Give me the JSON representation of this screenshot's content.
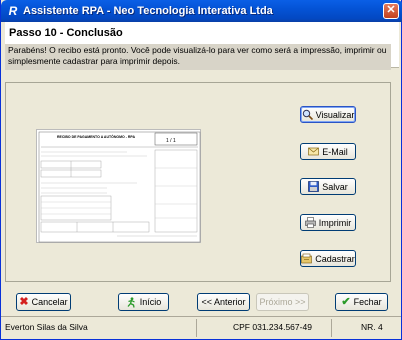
{
  "window": {
    "title": "Assistente RPA - Neo Tecnologia Interativa Ltda",
    "title_icon": "R",
    "close_label": "✕"
  },
  "step": {
    "title": "Passo 10 -  Conclusão",
    "info": "Parabéns! O recibo está pronto. Você pode visualizá-lo para ver como será a impressão, imprimir ou simplesmente cadastrar para imprimir depois."
  },
  "actions": {
    "visualizar": "Visualizar",
    "email": "E-Mail",
    "salvar": "Salvar",
    "imprimir": "Imprimir",
    "cadastrar": "Cadastrar"
  },
  "receipt": {
    "header": "RECIBO DE PAGAMENTO A AUTÔNOMO - RPA",
    "number": "1 / 1"
  },
  "nav": {
    "cancelar": "Cancelar",
    "inicio": "Início",
    "anterior": "<< Anterior",
    "proximo": "Próximo >>",
    "fechar": "Fechar"
  },
  "status": {
    "user": "Everton Silas da Silva",
    "cpf": "CPF 031.234.567-49",
    "number": "NR. 4"
  },
  "colors": {
    "titlebar": "#0453d6",
    "accent_green": "#2a9a2a",
    "cancel_red": "#d42020"
  }
}
